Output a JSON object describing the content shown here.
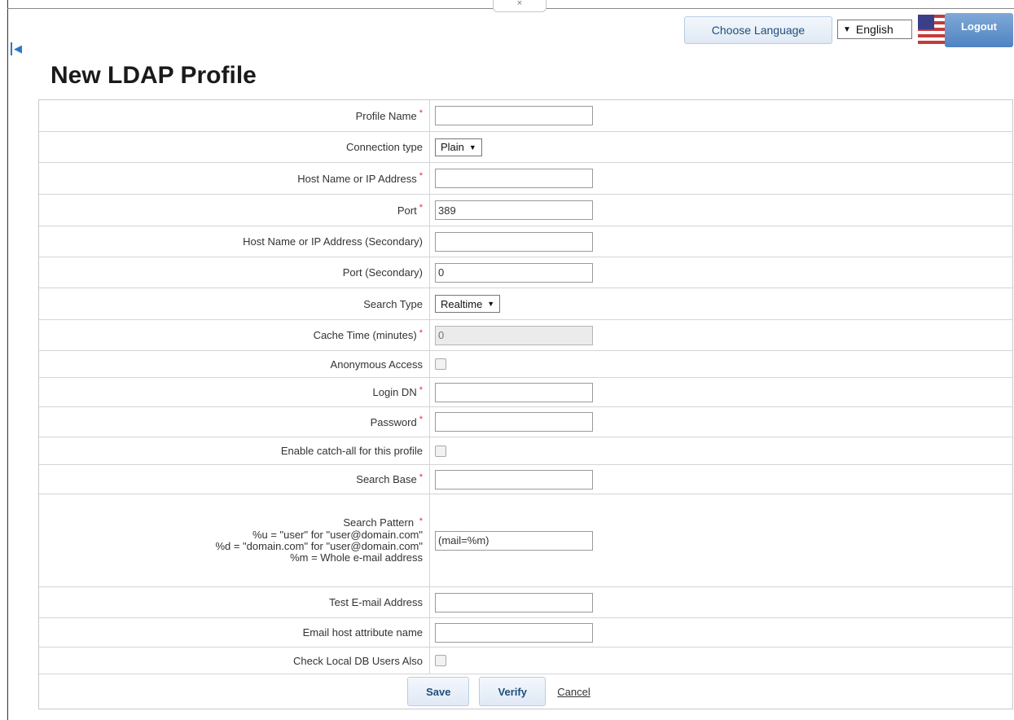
{
  "header": {
    "collapse_glyph": "×",
    "choose_language_label": "Choose Language",
    "language_value": "English",
    "logout_label": "Logout"
  },
  "page_title": "New LDAP Profile",
  "form": {
    "required_marker": "*",
    "rows": [
      {
        "label": "Profile Name",
        "required": true,
        "type": "text",
        "value": ""
      },
      {
        "label": "Connection type",
        "required": false,
        "type": "select",
        "value": "Plain"
      },
      {
        "label": "Host Name or IP Address",
        "required": true,
        "type": "text",
        "value": ""
      },
      {
        "label": "Port",
        "required": true,
        "type": "text",
        "value": "389"
      },
      {
        "label": "Host Name or IP Address (Secondary)",
        "required": false,
        "type": "text",
        "value": ""
      },
      {
        "label": "Port (Secondary)",
        "required": false,
        "type": "text",
        "value": "0"
      },
      {
        "label": "Search Type",
        "required": false,
        "type": "select",
        "value": "Realtime"
      },
      {
        "label": "Cache Time (minutes)",
        "required": true,
        "type": "text-disabled",
        "value": "0"
      },
      {
        "label": "Anonymous Access",
        "required": false,
        "type": "checkbox",
        "checked": false
      },
      {
        "label": "Login DN",
        "required": true,
        "type": "text",
        "value": ""
      },
      {
        "label": "Password",
        "required": true,
        "type": "text",
        "value": ""
      },
      {
        "label": "Enable catch-all for this profile",
        "required": false,
        "type": "checkbox",
        "checked": false
      },
      {
        "label": "Search Base",
        "required": true,
        "type": "text",
        "value": ""
      },
      {
        "label": "Search Pattern",
        "required": true,
        "type": "text",
        "value": "(mail=%m)",
        "help_lines": [
          "%u = \"user\" for \"user@domain.com\"",
          "%d = \"domain.com\" for \"user@domain.com\"",
          "%m = Whole e-mail address"
        ]
      },
      {
        "label": "Test E-mail Address",
        "required": false,
        "type": "text",
        "value": ""
      },
      {
        "label": "Email host attribute name",
        "required": false,
        "type": "text",
        "value": ""
      },
      {
        "label": "Check Local DB Users Also",
        "required": false,
        "type": "checkbox",
        "checked": false
      }
    ]
  },
  "actions": {
    "save_label": "Save",
    "verify_label": "Verify",
    "cancel_label": "Cancel"
  }
}
